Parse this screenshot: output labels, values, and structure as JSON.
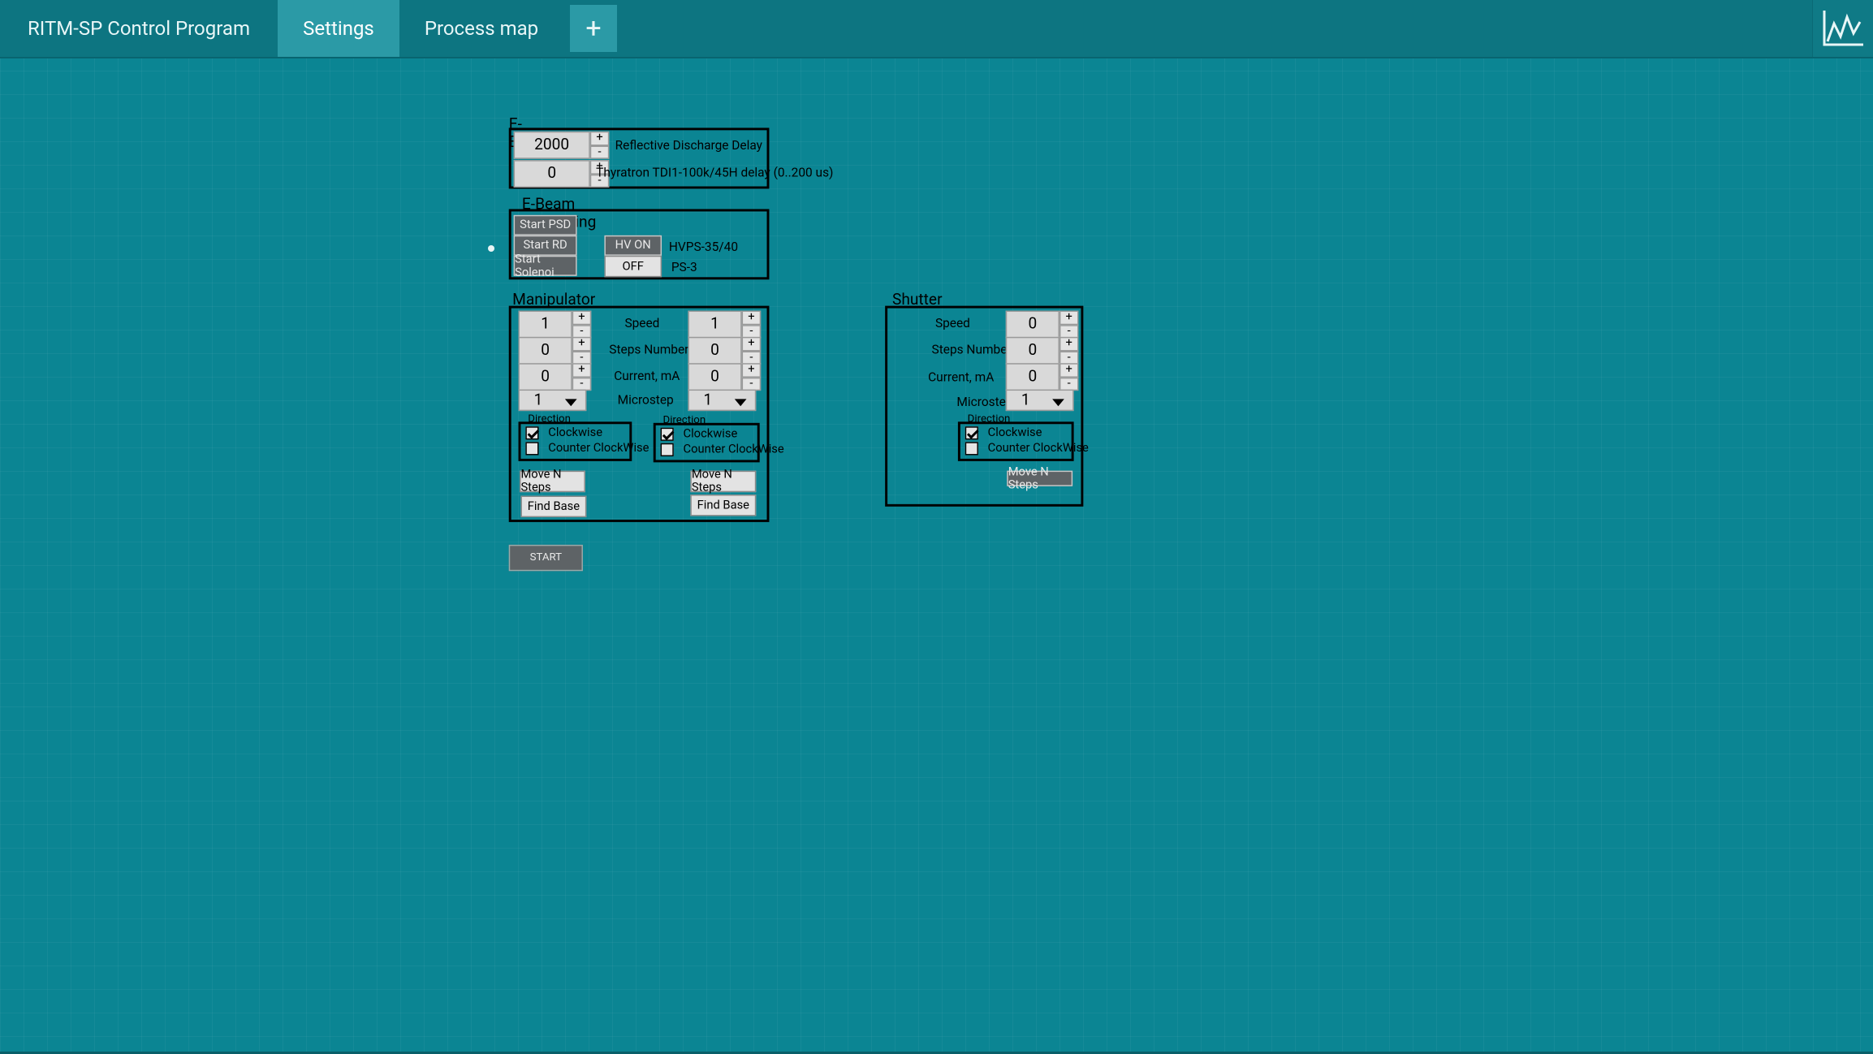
{
  "tabs": [
    "RITM-SP Control Program",
    "Settings",
    "Process map",
    "+"
  ],
  "ebeam": {
    "title": "E-Beam",
    "reflective_delay_value": "2000",
    "reflective_delay_label": "Reflective Discharge Delay",
    "thyratron_value": "0",
    "thyratron_label": "Thyratron TDI1-100k/45H delay (0..200 us)"
  },
  "debug": {
    "title": "E-Beam Debugging",
    "start_psd": "Start PSD",
    "start_rd": "Start RD",
    "start_solenoid": "Start Solenoi",
    "hv_on": "HV ON",
    "hvps_label": "HVPS-35/40",
    "off": "OFF",
    "ps3_label": "PS-3"
  },
  "manipulator": {
    "title": "Manipulator",
    "labels": {
      "speed": "Speed",
      "steps": "Steps Number",
      "current": "Current, mA",
      "microstep": "Microstep"
    },
    "left": {
      "speed": "1",
      "steps": "0",
      "current": "0",
      "microstep": "1",
      "direction_title": "Direction",
      "clockwise": "Clockwise",
      "counter": "Counter ClockWise",
      "clockwise_checked": true,
      "counter_checked": false,
      "move": "Move N Steps",
      "find": "Find Base"
    },
    "right": {
      "speed": "1",
      "steps": "0",
      "current": "0",
      "microstep": "1",
      "direction_title": "Direction",
      "clockwise": "Clockwise",
      "counter": "Counter ClockWise",
      "clockwise_checked": true,
      "counter_checked": false,
      "move": "Move N Steps",
      "find": "Find Base"
    }
  },
  "shutter": {
    "title": "Shutter",
    "labels": {
      "speed": "Speed",
      "steps": "Steps Number",
      "current": "Current, mA",
      "microstep": "Microstep"
    },
    "speed": "0",
    "steps": "0",
    "current": "0",
    "microstep": "1",
    "direction_title": "Direction",
    "clockwise": "Clockwise",
    "counter": "Counter ClockWise",
    "clockwise_checked": true,
    "counter_checked": false,
    "move": "Move N Steps"
  },
  "start_label": "START",
  "spin_plus": "+",
  "spin_minus": "-"
}
